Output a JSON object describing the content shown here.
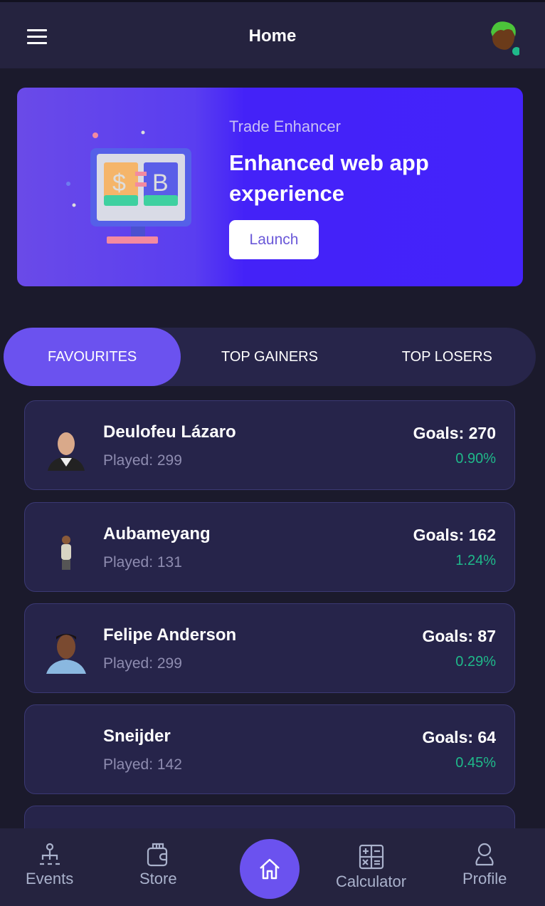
{
  "header": {
    "title": "Home",
    "menu_icon": "hamburger-icon",
    "avatar": "user-avatar",
    "status_color": "#1fb98a"
  },
  "banner": {
    "subtitle": "Trade Enhancer",
    "title": "Enhanced web app experience",
    "button": "Launch",
    "illustration": "currency-exchange-monitor"
  },
  "tabs": [
    {
      "label": "FAVOURITES",
      "active": true
    },
    {
      "label": "TOP GAINERS",
      "active": false
    },
    {
      "label": "TOP LOSERS",
      "active": false
    }
  ],
  "players": [
    {
      "name": "Deulofeu Lázaro",
      "played": "Played: 299",
      "goals": "Goals: 270",
      "change": "0.90%"
    },
    {
      "name": "Aubameyang",
      "played": "Played: 131",
      "goals": "Goals: 162",
      "change": "1.24%"
    },
    {
      "name": "Felipe Anderson",
      "played": "Played: 299",
      "goals": "Goals: 87",
      "change": "0.29%"
    },
    {
      "name": "Sneijder",
      "played": "Played: 142",
      "goals": "Goals: 64",
      "change": "0.45%"
    }
  ],
  "nav": [
    {
      "label": "Events",
      "icon": "hierarchy-icon"
    },
    {
      "label": "Store",
      "icon": "wallet-icon"
    },
    {
      "label": "Home",
      "icon": "home-icon",
      "active": true
    },
    {
      "label": "Calculator",
      "icon": "calculator-icon"
    },
    {
      "label": "Profile",
      "icon": "user-icon"
    }
  ],
  "colors": {
    "accent": "#6b52ef",
    "positive": "#1fb98a",
    "background": "#1b1a2c"
  }
}
